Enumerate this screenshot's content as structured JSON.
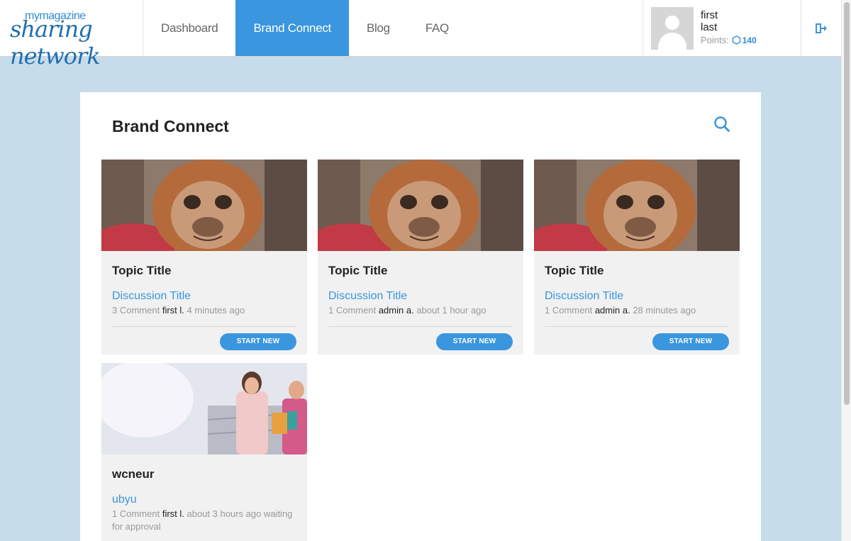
{
  "brand": {
    "top": "mymagazine",
    "bottom": "sharing network"
  },
  "nav": [
    {
      "label": "Dashboard",
      "active": false
    },
    {
      "label": "Brand Connect",
      "active": true
    },
    {
      "label": "Blog",
      "active": false
    },
    {
      "label": "FAQ",
      "active": false
    }
  ],
  "user": {
    "first": "first",
    "last": "last",
    "points_label": "Points:",
    "points": "140"
  },
  "page": {
    "title": "Brand Connect"
  },
  "cards": [
    {
      "image": "orangutan-photo",
      "topic": "Topic Title",
      "discussion": "Discussion Title",
      "comments": "3 Comment",
      "author": "first l.",
      "time": "4 minutes ago",
      "button": "START NEW"
    },
    {
      "image": "orangutan-photo",
      "topic": "Topic Title",
      "discussion": "Discussion Title",
      "comments": "1 Comment",
      "author": "admin a.",
      "time": "about 1 hour ago",
      "button": "START NEW"
    },
    {
      "image": "orangutan-photo",
      "topic": "Topic Title",
      "discussion": "Discussion Title",
      "comments": "1 Comment",
      "author": "admin a.",
      "time": "28 minutes ago",
      "button": "START NEW"
    },
    {
      "image": "women-shopping-photo",
      "topic": "wcneur",
      "discussion": "ubyu",
      "comments": "1 Comment",
      "author": "first l.",
      "time": "about 3 hours ago waiting for approval"
    }
  ],
  "colors": {
    "accent": "#3a96de",
    "page_bg": "#c7dceb",
    "card_bg": "#f1f1f1"
  }
}
